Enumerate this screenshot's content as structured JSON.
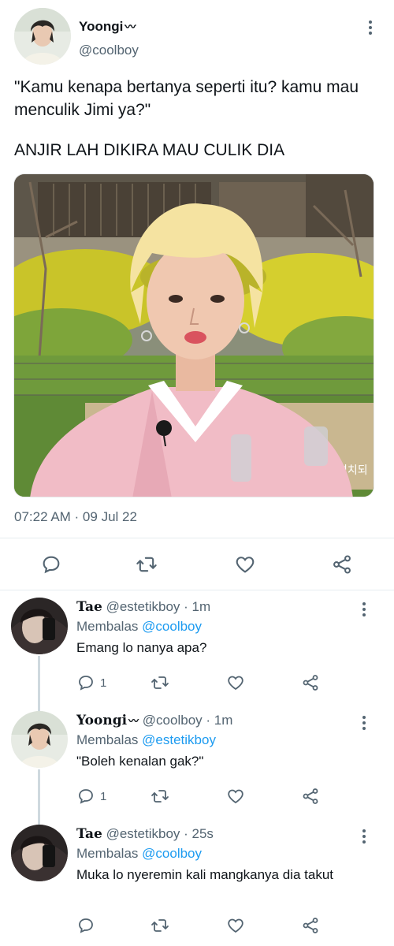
{
  "main_tweet": {
    "display_name": "Yoongi",
    "name_suffix_emoji": "〰",
    "handle": "@coolboy",
    "text_line1": "\"Kamu kenapa bertanya seperti itu? kamu mau menculik Jimi ya?\"",
    "text_line2": "ANJIR LAH DIKIRA MAU CULIK DIA",
    "photo_sign_text": "설치되",
    "timestamp": "07:22 AM · 09 Jul 22"
  },
  "replies": [
    {
      "display_name": "Tae",
      "handle": "@estetikboy",
      "time": "· 1m",
      "replying_label": "Membalas",
      "replying_to": "@coolboy",
      "text": "Emang lo nanya apa?",
      "reply_count": "1"
    },
    {
      "display_name": "Yoongi",
      "name_suffix_emoji": "〰",
      "handle": "@coolboy",
      "time": "· 1m",
      "replying_label": "Membalas",
      "replying_to": "@estetikboy",
      "text": "\"Boleh kenalan gak?\"",
      "reply_count": "1"
    },
    {
      "display_name": "Tae",
      "handle": "@estetikboy",
      "time": "· 25s",
      "replying_label": "Membalas",
      "replying_to": "@coolboy",
      "text": "Muka lo nyeremin kali mangkanya dia takut",
      "reply_count": ""
    }
  ],
  "icons": {
    "reply": "reply-icon",
    "retweet": "retweet-icon",
    "like": "heart-icon",
    "share": "share-icon",
    "more": "more-vertical-icon"
  },
  "colors": {
    "text": "#0f1419",
    "secondary": "#536471",
    "accent": "#1d9bf0",
    "divider": "#e6ecf0"
  }
}
